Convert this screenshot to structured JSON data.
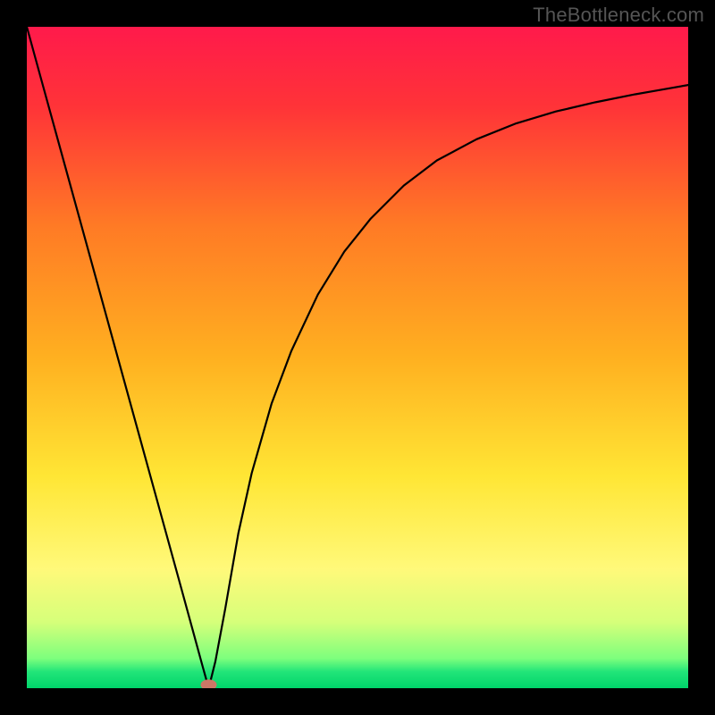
{
  "watermark": "TheBottleneck.com",
  "chart_data": {
    "type": "line",
    "title": "",
    "xlabel": "",
    "ylabel": "",
    "xlim": [
      0,
      100
    ],
    "ylim": [
      0,
      100
    ],
    "grid": false,
    "legend": false,
    "annotations": [],
    "background_gradient": {
      "stops": [
        {
          "offset": 0.0,
          "color": "#ff1a4b"
        },
        {
          "offset": 0.12,
          "color": "#ff3338"
        },
        {
          "offset": 0.3,
          "color": "#ff7a25"
        },
        {
          "offset": 0.5,
          "color": "#ffb020"
        },
        {
          "offset": 0.68,
          "color": "#ffe635"
        },
        {
          "offset": 0.82,
          "color": "#fff97a"
        },
        {
          "offset": 0.9,
          "color": "#d6ff7a"
        },
        {
          "offset": 0.955,
          "color": "#7dff7d"
        },
        {
          "offset": 0.975,
          "color": "#22e579"
        },
        {
          "offset": 1.0,
          "color": "#00d46a"
        }
      ]
    },
    "marker": {
      "x": 27.5,
      "y": 0.5,
      "color": "#cc7766"
    },
    "series": [
      {
        "name": "curve",
        "x": [
          0.0,
          2.0,
          5.0,
          8.0,
          11.0,
          14.0,
          17.0,
          20.0,
          23.0,
          25.0,
          26.5,
          27.5,
          28.5,
          30.0,
          32.0,
          34.0,
          37.0,
          40.0,
          44.0,
          48.0,
          52.0,
          57.0,
          62.0,
          68.0,
          74.0,
          80.0,
          86.0,
          92.0,
          96.0,
          100.0
        ],
        "y": [
          100.0,
          92.7,
          81.8,
          70.9,
          60.0,
          49.1,
          38.2,
          27.3,
          16.4,
          9.1,
          3.6,
          0.0,
          4.0,
          12.0,
          23.5,
          32.5,
          43.0,
          51.0,
          59.5,
          66.0,
          71.0,
          76.0,
          79.8,
          83.0,
          85.4,
          87.2,
          88.6,
          89.8,
          90.5,
          91.2
        ]
      }
    ]
  }
}
